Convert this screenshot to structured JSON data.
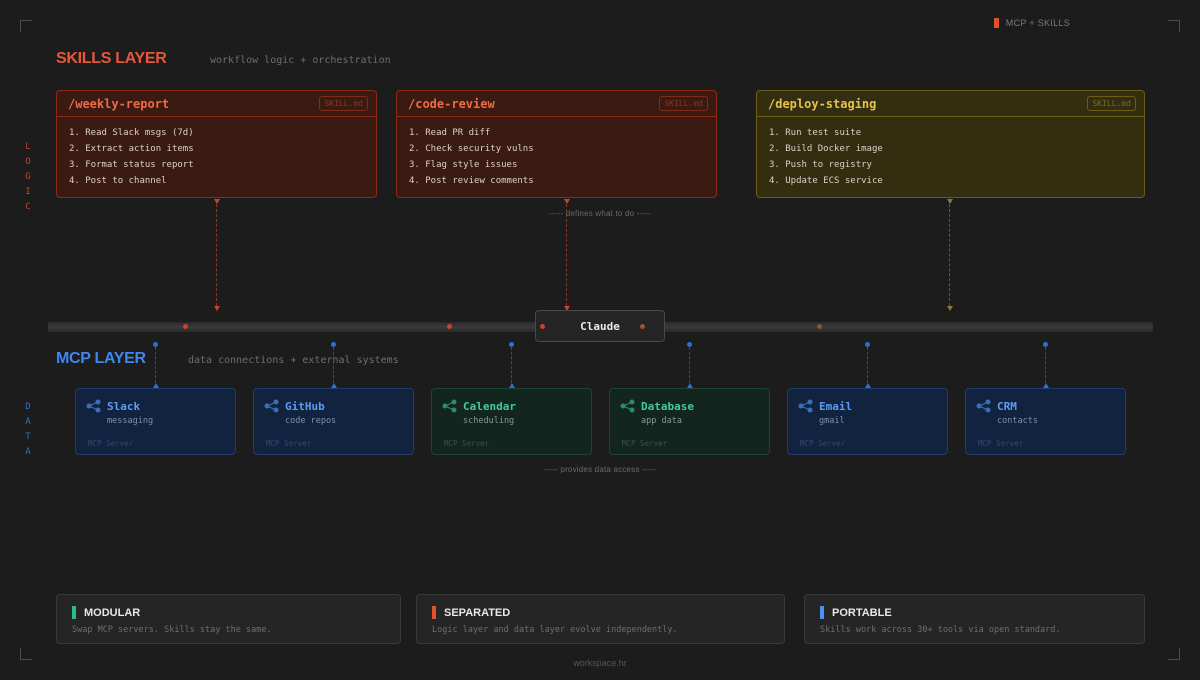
{
  "header": {
    "tag": "MCP + SKILLS"
  },
  "skills_layer": {
    "title": "SKILLS LAYER",
    "subtitle": "workflow logic + orchestration",
    "side_label": [
      "L",
      "O",
      "G",
      "I",
      "C"
    ],
    "caption": "----- defines what to do -----",
    "cards": [
      {
        "name": "/weekly-report",
        "badge": "SKILL.md",
        "steps": [
          "1. Read Slack msgs (7d)",
          "2. Extract action items",
          "3. Format status report",
          "4. Post to channel"
        ]
      },
      {
        "name": "/code-review",
        "badge": "SKILL.md",
        "steps": [
          "1. Read PR diff",
          "2. Check security vulns",
          "3. Flag style issues",
          "4. Post review comments"
        ]
      },
      {
        "name": "/deploy-staging",
        "badge": "SKILL.md",
        "steps": [
          "1. Run test suite",
          "2. Build Docker image",
          "3. Push to registry",
          "4. Update ECS service"
        ]
      }
    ]
  },
  "core": {
    "label": "Claude"
  },
  "mcp_layer": {
    "title": "MCP LAYER",
    "subtitle": "data connections + external systems",
    "side_label": [
      "D",
      "A",
      "T",
      "A"
    ],
    "caption": "----- provides data access -----",
    "cards": [
      {
        "name": "Slack",
        "desc": "messaging",
        "type": "MCP Server"
      },
      {
        "name": "GitHub",
        "desc": "code repos",
        "type": "MCP Server"
      },
      {
        "name": "Calendar",
        "desc": "scheduling",
        "type": "MCP Server"
      },
      {
        "name": "Database",
        "desc": "app data",
        "type": "MCP Server"
      },
      {
        "name": "Email",
        "desc": "gmail",
        "type": "MCP Server"
      },
      {
        "name": "CRM",
        "desc": "contacts",
        "type": "MCP Server"
      }
    ]
  },
  "principles": [
    {
      "title": "MODULAR",
      "desc": "Swap MCP servers. Skills stay the same.",
      "color": "#2fb98a"
    },
    {
      "title": "SEPARATED",
      "desc": "Logic layer and data layer evolve independently.",
      "color": "#e0522d"
    },
    {
      "title": "PORTABLE",
      "desc": "Skills work across 30+ tools via open standard.",
      "color": "#4f8ef2"
    }
  ],
  "footer": {
    "text": "workspace.hr"
  },
  "colors": {
    "skill_red": "#f06a45",
    "skill_olive": "#e7c24a",
    "mcp_blue": "#5d9cf0",
    "mcp_green": "#45c9a0"
  }
}
